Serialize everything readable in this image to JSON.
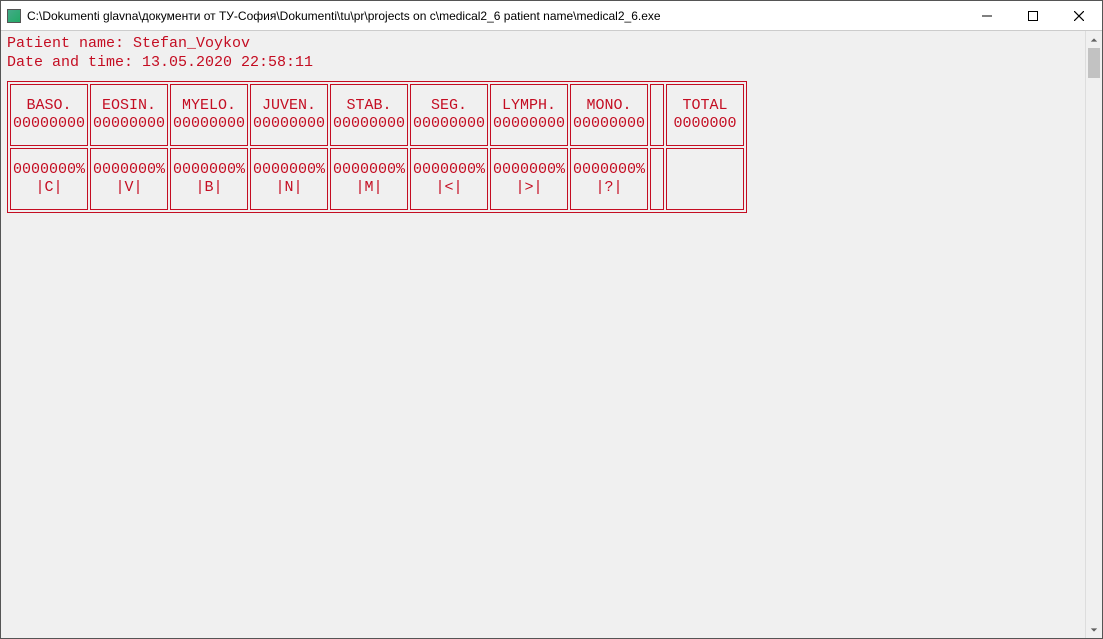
{
  "window": {
    "title": "C:\\Dokumenti glavna\\документи от ТУ-София\\Dokumenti\\tu\\pr\\projects on c\\medical2_6 patient name\\medical2_6.exe"
  },
  "header": {
    "patient_label": "Patient name: ",
    "patient_name": "Stefan_Voykov",
    "datetime_label": "Date and time: ",
    "datetime_value": "13.05.2020 22:58:11"
  },
  "cells_row1": [
    {
      "top": "BASO.",
      "bot": "00000000"
    },
    {
      "top": "EOSIN.",
      "bot": "00000000"
    },
    {
      "top": "MYELO.",
      "bot": "00000000"
    },
    {
      "top": "JUVEN.",
      "bot": "00000000"
    },
    {
      "top": "STAB.",
      "bot": "00000000"
    },
    {
      "top": "SEG.",
      "bot": "00000000"
    },
    {
      "top": "LYMPH.",
      "bot": "00000000"
    },
    {
      "top": "MONO.",
      "bot": "00000000"
    }
  ],
  "cells_row2": [
    {
      "top": "0000000%",
      "bot": "|C|"
    },
    {
      "top": "0000000%",
      "bot": "|V|"
    },
    {
      "top": "0000000%",
      "bot": "|B|"
    },
    {
      "top": "0000000%",
      "bot": "|N|"
    },
    {
      "top": "0000000%",
      "bot": "|M|"
    },
    {
      "top": "0000000%",
      "bot": "|<|"
    },
    {
      "top": "0000000%",
      "bot": "|>|"
    },
    {
      "top": "0000000%",
      "bot": "|?|"
    }
  ],
  "total": {
    "label": "TOTAL",
    "value": "0000000"
  }
}
